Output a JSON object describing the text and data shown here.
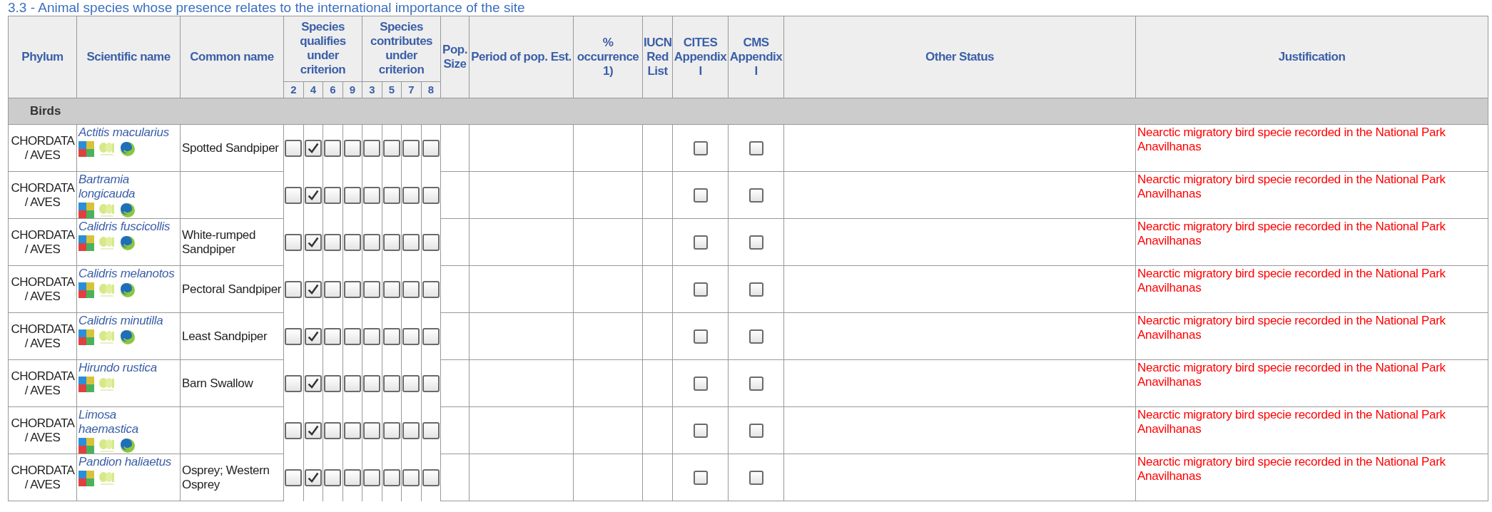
{
  "title": "3.3 - Animal species whose presence relates to the international importance of the site",
  "columns": [
    {
      "kind": "text",
      "label": "Phylum"
    },
    {
      "kind": "text",
      "label": "Scientific name"
    },
    {
      "kind": "text",
      "label": "Common name"
    },
    {
      "kind": "group",
      "label": "Species qualifies under criterion",
      "criteria": [
        "2",
        "4",
        "6",
        "9"
      ]
    },
    {
      "kind": "group",
      "label": "Species contributes under criterion",
      "criteria": [
        "3",
        "5",
        "7",
        "8"
      ]
    },
    {
      "kind": "text",
      "label": "Pop. Size"
    },
    {
      "kind": "text",
      "label": "Period of pop. Est."
    },
    {
      "kind": "text",
      "label": "% occurrence 1)"
    },
    {
      "kind": "text",
      "label": "IUCN Red List"
    },
    {
      "kind": "text",
      "label": "CITES Appendix I"
    },
    {
      "kind": "text",
      "label": "CMS Appendix I"
    },
    {
      "kind": "text",
      "label": "Other Status"
    },
    {
      "kind": "text",
      "label": "Justification"
    }
  ],
  "group": "Birds",
  "rows": [
    {
      "phylum": "CHORDATA / AVES",
      "scientific_name": "Actitis macularius",
      "links": [
        {
          "kind": "tiles"
        },
        {
          "kind": "leaf"
        },
        {
          "kind": "globe"
        }
      ],
      "common_name": "Spotted Sandpiper",
      "qualifies": [
        false,
        true,
        false,
        false
      ],
      "contributes": [
        false,
        false,
        false,
        false
      ],
      "cites": false,
      "cms": false,
      "justification": "Nearctic migratory bird specie recorded in the National Park Anavilhanas"
    },
    {
      "phylum": "CHORDATA / AVES",
      "scientific_name": "Bartramia longicauda",
      "links": [
        {
          "kind": "tiles"
        },
        {
          "kind": "leaf"
        },
        {
          "kind": "globe"
        }
      ],
      "qualifies": [
        false,
        true,
        false,
        false
      ],
      "contributes": [
        false,
        false,
        false,
        false
      ],
      "cites": false,
      "cms": false,
      "justification": "Nearctic migratory bird specie recorded in the National Park Anavilhanas"
    },
    {
      "phylum": "CHORDATA / AVES",
      "scientific_name": "Calidris fuscicollis",
      "links": [
        {
          "kind": "tiles"
        },
        {
          "kind": "leaf"
        },
        {
          "kind": "globe"
        }
      ],
      "common_name": "White-rumped Sandpiper",
      "qualifies": [
        false,
        true,
        false,
        false
      ],
      "contributes": [
        false,
        false,
        false,
        false
      ],
      "cites": false,
      "cms": false,
      "justification": "Nearctic migratory bird specie recorded in the National Park Anavilhanas"
    },
    {
      "phylum": "CHORDATA / AVES",
      "scientific_name": "Calidris melanotos",
      "links": [
        {
          "kind": "tiles"
        },
        {
          "kind": "leaf"
        },
        {
          "kind": "globe"
        }
      ],
      "common_name": "Pectoral Sandpiper",
      "qualifies": [
        false,
        true,
        false,
        false
      ],
      "contributes": [
        false,
        false,
        false,
        false
      ],
      "cites": false,
      "cms": false,
      "justification": "Nearctic migratory bird specie recorded in the National Park Anavilhanas"
    },
    {
      "phylum": "CHORDATA / AVES",
      "scientific_name": "Calidris minutilla",
      "links": [
        {
          "kind": "tiles"
        },
        {
          "kind": "leaf"
        },
        {
          "kind": "globe"
        }
      ],
      "common_name": "Least Sandpiper",
      "qualifies": [
        false,
        true,
        false,
        false
      ],
      "contributes": [
        false,
        false,
        false,
        false
      ],
      "cites": false,
      "cms": false,
      "justification": "Nearctic migratory bird specie recorded in the National Park Anavilhanas"
    },
    {
      "phylum": "CHORDATA / AVES",
      "scientific_name": "Hirundo rustica",
      "links": [
        {
          "kind": "tiles"
        },
        {
          "kind": "leaf"
        }
      ],
      "common_name": "Barn Swallow",
      "qualifies": [
        false,
        true,
        false,
        false
      ],
      "contributes": [
        false,
        false,
        false,
        false
      ],
      "cites": false,
      "cms": false,
      "justification": "Nearctic migratory bird specie recorded in the National Park Anavilhanas"
    },
    {
      "phylum": "CHORDATA / AVES",
      "scientific_name": "Limosa haemastica",
      "links": [
        {
          "kind": "tiles"
        },
        {
          "kind": "leaf"
        },
        {
          "kind": "globe"
        }
      ],
      "qualifies": [
        false,
        true,
        false,
        false
      ],
      "contributes": [
        false,
        false,
        false,
        false
      ],
      "cites": false,
      "cms": false,
      "justification": "Nearctic migratory bird specie recorded in the National Park Anavilhanas"
    },
    {
      "phylum": "CHORDATA / AVES",
      "scientific_name": "Pandion haliaetus",
      "links": [
        {
          "kind": "tiles"
        },
        {
          "kind": "leaf"
        }
      ],
      "common_name": "Osprey; Western Osprey",
      "qualifies": [
        false,
        true,
        false,
        false
      ],
      "contributes": [
        false,
        false,
        false,
        false
      ],
      "cites": false,
      "cms": false,
      "justification": "Nearctic migratory bird specie recorded in the National Park Anavilhanas"
    }
  ]
}
